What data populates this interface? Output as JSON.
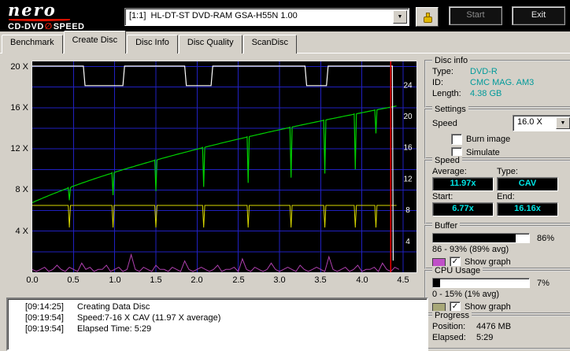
{
  "header": {
    "logo_title": "nero",
    "logo_sub_a": "CD-DVD",
    "logo_symbol": "∅",
    "logo_sub_b": "SPEED",
    "drive": "[1:1]  HL-DT-ST DVD-RAM GSA-H55N 1.00",
    "start_label": "Start",
    "exit_label": "Exit"
  },
  "icons": {
    "dropdown": "▼",
    "check": "✓"
  },
  "tabs": [
    {
      "label": "Benchmark",
      "active": false
    },
    {
      "label": "Create Disc",
      "active": true
    },
    {
      "label": "Disc Info",
      "active": false
    },
    {
      "label": "Disc Quality",
      "active": false
    },
    {
      "label": "ScanDisc",
      "active": false
    }
  ],
  "chart": {
    "type": "line",
    "grid_color": "#2020c0",
    "x_axis": {
      "ticks": [
        "0.0",
        "0.5",
        "1.0",
        "1.5",
        "2.0",
        "2.5",
        "3.0",
        "3.5",
        "4.0",
        "4.5"
      ],
      "max_tick": 4.5
    },
    "left_axis": {
      "ticks": [
        "20 X",
        "16 X",
        "12 X",
        "8 X",
        "4 X"
      ],
      "max": 20.5
    },
    "right_axis": {
      "ticks": [
        24,
        20,
        16,
        12,
        8,
        4
      ],
      "max": 27
    },
    "series": {
      "write_speed": {
        "color": "#00d200",
        "start": 6.77,
        "end": 16.16,
        "xmax": 4.42,
        "spikes": [
          [
            0.45,
            7.0
          ],
          [
            0.98,
            7.5
          ],
          [
            1.5,
            7.9
          ],
          [
            2.08,
            8.3
          ],
          [
            2.62,
            8.7
          ],
          [
            3.14,
            9.2
          ],
          [
            3.55,
            9.6
          ],
          [
            3.92,
            10.0
          ],
          [
            4.17,
            13.5
          ]
        ]
      },
      "rotation": {
        "color": "#d8d800",
        "level": 6.5,
        "spike_dip": 4.35,
        "xmax": 4.42
      },
      "buffer": {
        "color": "#ffffff",
        "points": [
          [
            0,
            26.4
          ],
          [
            0.62,
            26.4
          ],
          [
            0.64,
            23.9
          ],
          [
            1.1,
            23.9
          ],
          [
            1.12,
            26.4
          ],
          [
            1.85,
            26.4
          ],
          [
            1.87,
            23.9
          ],
          [
            2.17,
            23.9
          ],
          [
            2.19,
            26.4
          ],
          [
            3.31,
            26.4
          ],
          [
            3.33,
            23.9
          ],
          [
            3.57,
            23.9
          ],
          [
            3.59,
            26.4
          ],
          [
            4.37,
            26.4
          ],
          [
            4.38,
            1.5
          ]
        ]
      },
      "cpu": {
        "color": "#b040b0",
        "step": 0.05,
        "values": [
          1,
          0,
          1,
          2,
          0,
          1,
          3,
          1,
          0,
          2,
          1,
          0,
          4,
          1,
          2,
          0,
          1,
          1,
          3,
          0,
          1,
          2,
          0,
          1,
          8,
          1,
          0,
          2,
          1,
          0,
          3,
          1,
          1,
          0,
          2,
          1,
          0,
          5,
          1,
          0,
          1,
          2,
          1,
          0,
          1,
          3,
          0,
          1,
          1,
          2,
          0,
          6,
          1,
          0,
          2,
          1,
          0,
          1,
          4,
          1,
          0,
          1,
          2,
          1,
          0,
          3,
          1,
          0,
          1,
          2,
          1,
          0,
          7,
          1,
          0,
          1,
          2,
          0,
          1,
          3,
          0,
          1,
          1,
          2,
          0,
          4,
          1,
          0,
          2,
          1
        ]
      },
      "position_marker": {
        "color": "#f20000",
        "x": 4.35
      }
    }
  },
  "disc_info": {
    "legend": "Disc info",
    "rows": [
      {
        "label": "Type:",
        "value": "DVD-R"
      },
      {
        "label": "ID:",
        "value": "CMC MAG. AM3"
      },
      {
        "label": "Length:",
        "value": "4.38 GB"
      }
    ]
  },
  "settings": {
    "legend": "Settings",
    "speed_label": "Speed",
    "speed_value": "16.0 X",
    "checkboxes": [
      {
        "label": "Burn image",
        "checked": false
      },
      {
        "label": "Simulate",
        "checked": false
      }
    ]
  },
  "speed_panel": {
    "legend": "Speed",
    "average_label": "Average:",
    "average": "11.97x",
    "type_label": "Type:",
    "type": "CAV",
    "start_label": "Start:",
    "start": "6.77x",
    "end_label": "End:",
    "end": "16.16x"
  },
  "buffer_panel": {
    "legend": "Buffer",
    "percent": "86%",
    "fill": 86,
    "range": "86 - 93% (89% avg)",
    "show_graph_label": "Show graph",
    "show_graph_checked": true,
    "swatch": "#c050c8"
  },
  "cpu_panel": {
    "legend": "CPU Usage",
    "percent": "7%",
    "fill": 7,
    "range": "0 - 15% (1% avg)",
    "show_graph_label": "Show graph",
    "show_graph_checked": true,
    "swatch": "#a8a878"
  },
  "progress_panel": {
    "legend": "Progress",
    "position_label": "Position:",
    "position": "4476 MB",
    "elapsed_label": "Elapsed:",
    "elapsed": "5:29"
  },
  "log": {
    "entries": [
      {
        "time": "[09:14:25]",
        "text": "Creating Data Disc"
      },
      {
        "time": "[09:19:54]",
        "text": "Speed:7-16 X CAV (11.97 X average)"
      },
      {
        "time": "[09:19:54]",
        "text": "Elapsed Time: 5:29"
      }
    ]
  }
}
